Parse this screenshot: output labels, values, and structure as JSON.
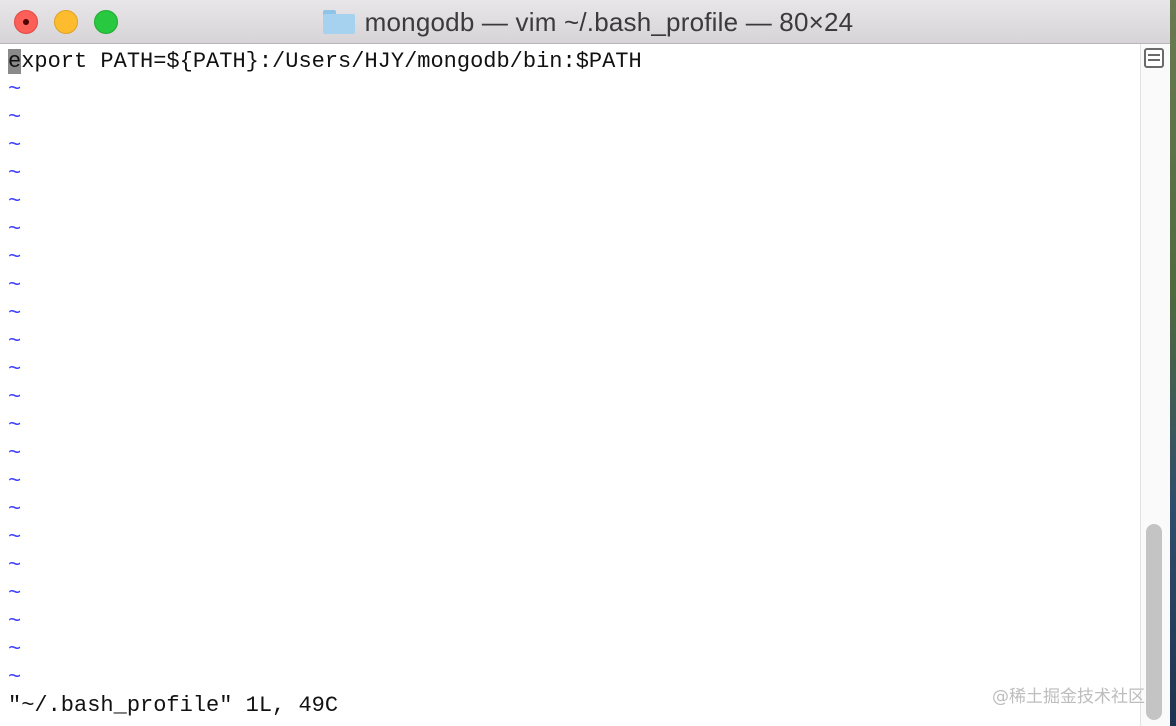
{
  "window": {
    "title": "mongodb — vim ~/.bash_profile — 80×24",
    "title_icon": "folder-icon"
  },
  "editor": {
    "cursor_char": "e",
    "line1_rest": "xport PATH=${PATH}:/Users/HJY/mongodb/bin:$PATH",
    "tilde": "~",
    "status": "\"~/.bash_profile\" 1L, 49C"
  },
  "watermark": "@稀土掘金技术社区",
  "colors": {
    "tilde": "#3b3bff",
    "text": "#111111",
    "cursor": "#8a8a8a",
    "close": "#fc5f57",
    "minimize": "#fdbc2e",
    "maximize": "#28c840"
  }
}
